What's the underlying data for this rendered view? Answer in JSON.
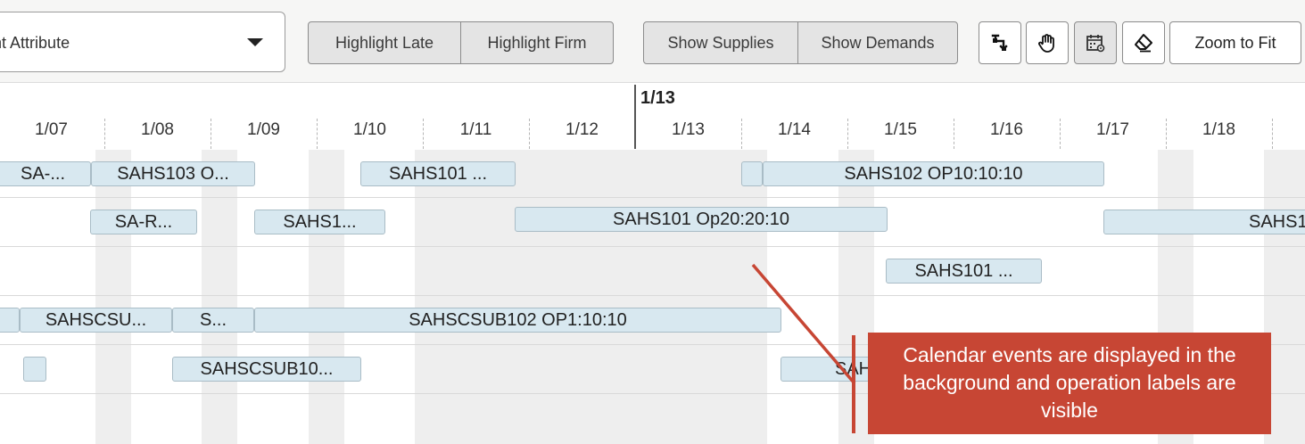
{
  "toolbar": {
    "attribute_select": {
      "value": "Highlight Attribute"
    },
    "highlight_group": [
      "Highlight Late",
      "Highlight Firm"
    ],
    "show_group": [
      "Show Supplies",
      "Show Demands"
    ],
    "icon_buttons": [
      "select-tool-icon",
      "pan-hand-icon",
      "calendar-settings-icon",
      "eraser-icon"
    ],
    "zoom_to_fit_label": "Zoom to Fit"
  },
  "timeline": {
    "current_date": "1/13",
    "dates": [
      "1/07",
      "1/08",
      "1/09",
      "1/10",
      "1/11",
      "1/12",
      "1/13",
      "1/14",
      "1/15",
      "1/16",
      "1/17",
      "1/18"
    ]
  },
  "rows": [
    {
      "bars": [
        "SA-...",
        "SAHS103 O...",
        "SAHS101 ...",
        "",
        "SAHS102 OP10:10:10"
      ]
    },
    {
      "bars": [
        "SA-R...",
        "SAHS1...",
        "SAHS101 Op20:20:10",
        "SAHS1"
      ]
    },
    {
      "bars": [
        "SAHS101 ..."
      ]
    },
    {
      "bars": [
        "",
        "SAHSCSU...",
        "S...",
        "SAHSCSUB102 OP1:10:10"
      ]
    },
    {
      "bars": [
        "",
        "SAHSCSUB10...",
        "SAH"
      ]
    }
  ],
  "callout": {
    "text": "Calendar events are displayed in the background and operation labels are visible"
  },
  "colors": {
    "bar_fill": "#d8e8f0",
    "bar_border": "#a9bcc6",
    "callout": "#c74634",
    "calendar_band": "#eeeeee"
  }
}
